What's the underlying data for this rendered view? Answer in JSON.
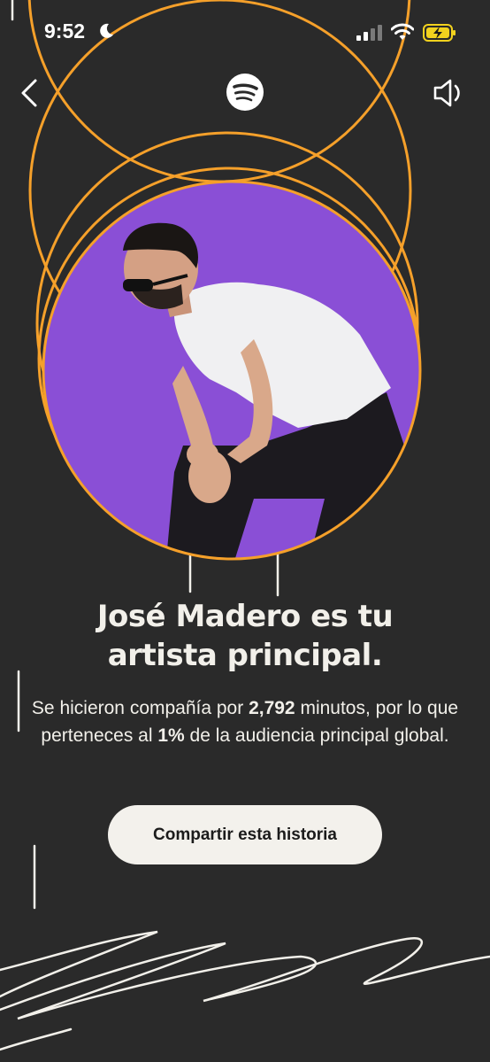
{
  "status_bar": {
    "time": "9:52"
  },
  "story": {
    "headline_line1": "José Madero es tu",
    "headline_line2": "artista principal.",
    "subtext_pre": "Se hicieron compañía por ",
    "minutes": "2,792",
    "subtext_mid": " minutos, por lo que perteneces al ",
    "percent": "1%",
    "subtext_post": " de la audiencia principal global.",
    "share_button": "Compartir esta historia"
  },
  "icons": {
    "back": "chevron-left-icon",
    "logo": "spotify-logo",
    "sound": "speaker-icon",
    "moon": "moon-icon",
    "signal": "cellular-signal-icon",
    "wifi": "wifi-icon",
    "battery": "battery-charging-icon"
  },
  "colors": {
    "background": "#2a2a2a",
    "ring": "#f5a02a",
    "photo_background": "#8a4fd6",
    "text": "#f2f0ea",
    "button": "#f3f1ec",
    "battery": "#f2d21e"
  }
}
